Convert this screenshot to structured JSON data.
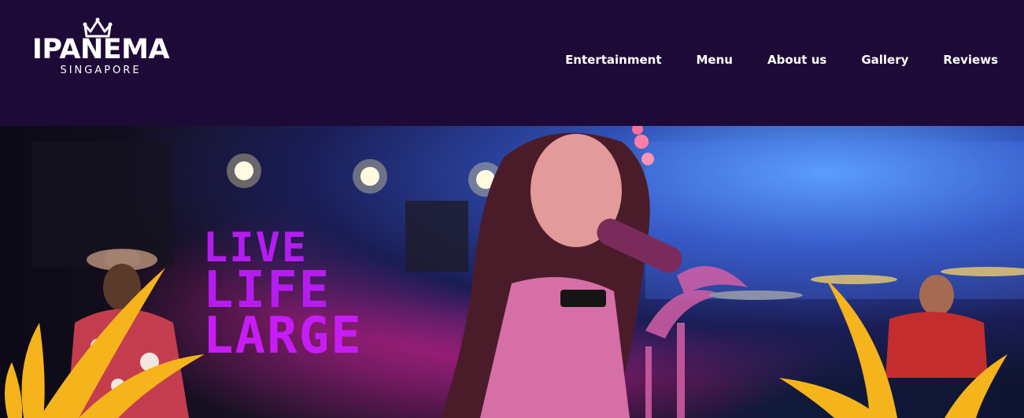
{
  "brand": {
    "name": "IPANEMA",
    "location": "SINGAPORE",
    "logo_icon": "crown-icon"
  },
  "nav": {
    "items": [
      {
        "label": "Entertainment"
      },
      {
        "label": "Menu"
      },
      {
        "label": "About us"
      },
      {
        "label": "Gallery"
      },
      {
        "label": "Reviews"
      }
    ]
  },
  "hero": {
    "headline": [
      "LIVE",
      "LIFE",
      "LARGE"
    ]
  },
  "colors": {
    "header_bg": "#1e0a37",
    "headline": "#b51cf0",
    "leaf": "#f5b31c"
  }
}
